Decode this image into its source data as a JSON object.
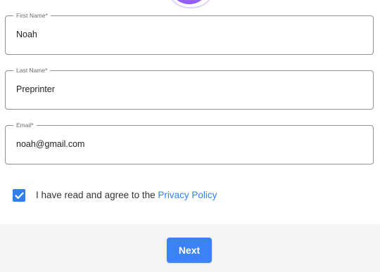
{
  "form": {
    "first_name": {
      "label": "First Name*",
      "value": "Noah"
    },
    "last_name": {
      "label": "Last Name*",
      "value": "Preprinter"
    },
    "email": {
      "label": "Email*",
      "value": "noah@gmail.com"
    }
  },
  "consent": {
    "checked": true,
    "text": "I have read and agree to the ",
    "link_text": "Privacy Policy"
  },
  "footer": {
    "next_label": "Next"
  },
  "colors": {
    "accent": "#3b82f6",
    "link": "#2f80ed",
    "avatar": "#8f57f5"
  },
  "icons": {
    "checkbox": "checkmark-icon"
  }
}
